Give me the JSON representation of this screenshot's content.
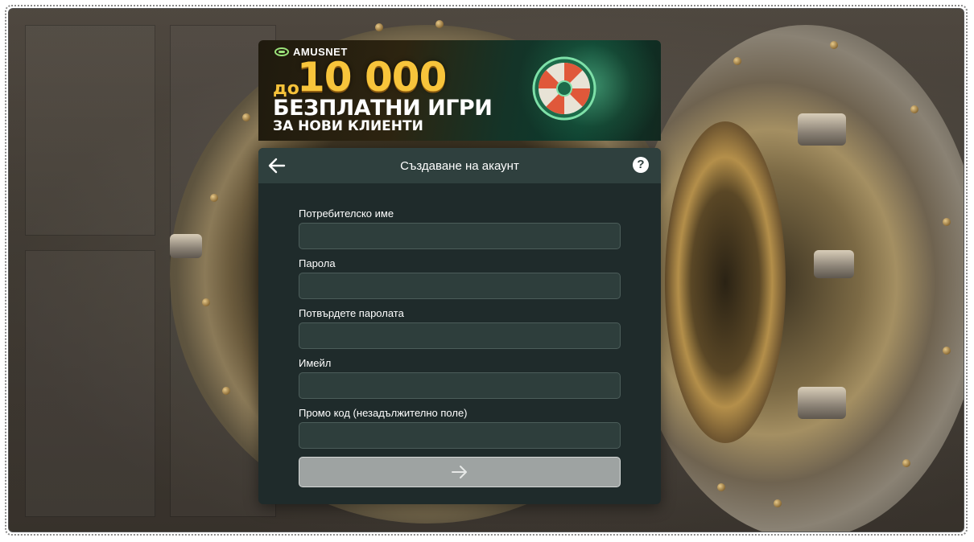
{
  "banner": {
    "brand": "AMUSNET",
    "prefix": "до",
    "amount": "10 000",
    "line1": "БЕЗПЛАТНИ ИГРИ",
    "line2": "ЗА НОВИ КЛИЕНТИ"
  },
  "header": {
    "title": "Създаване на акаунт",
    "back_icon": "arrow-left-icon",
    "help_symbol": "?"
  },
  "form": {
    "fields": [
      {
        "label": "Потребителско име",
        "value": ""
      },
      {
        "label": "Парола",
        "value": ""
      },
      {
        "label": "Потвърдете паролата",
        "value": ""
      },
      {
        "label": "Имейл",
        "value": ""
      },
      {
        "label": "Промо код (незадължително поле)",
        "value": ""
      }
    ],
    "submit_icon": "arrow-right-icon"
  },
  "colors": {
    "panel_bg": "#1f2b2b",
    "header_bg": "#2f403e",
    "input_bg": "#2e3e3c",
    "submit_bg": "#9ea3a2",
    "gold": "#f7c43b"
  }
}
